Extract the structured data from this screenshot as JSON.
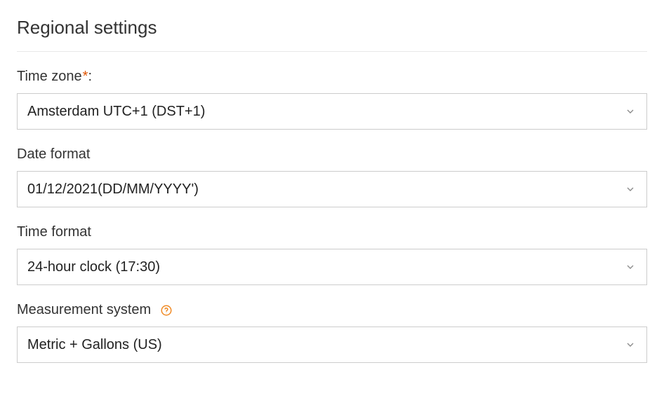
{
  "heading": "Regional settings",
  "fields": {
    "timezone": {
      "label": "Time zone",
      "colon": ":",
      "required_marker": "*",
      "value": "Amsterdam UTC+1 (DST+1)"
    },
    "dateformat": {
      "label": "Date format",
      "value": "01/12/2021(DD/MM/YYYY')"
    },
    "timeformat": {
      "label": "Time format",
      "value": "24-hour clock (17:30)"
    },
    "measurement": {
      "label": "Measurement system",
      "value": "Metric + Gallons (US)"
    }
  }
}
